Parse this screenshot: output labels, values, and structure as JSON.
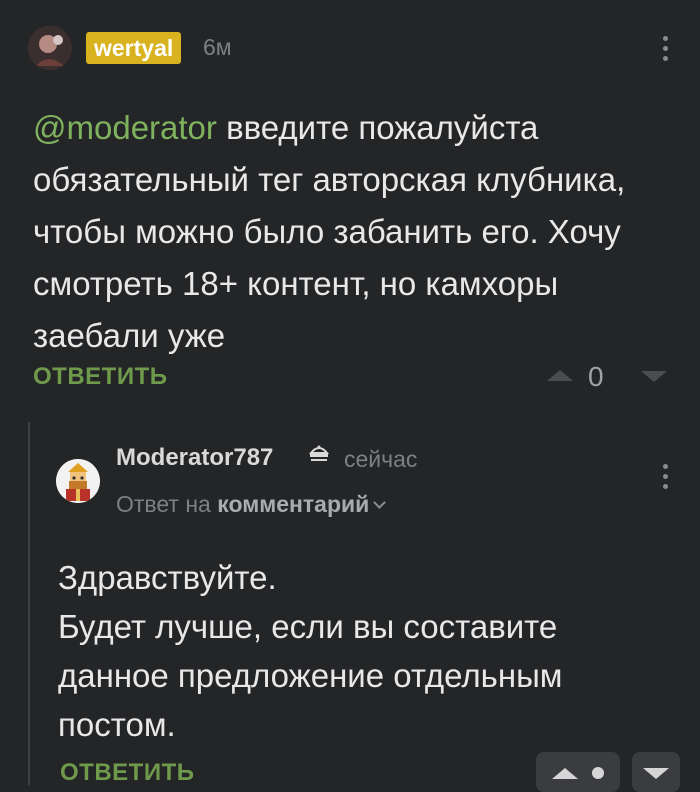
{
  "comment": {
    "author": "wertyal",
    "time": "6м",
    "mention": "@moderator",
    "text": " введите пожалуйста обязательный тег авторская клубника, чтобы можно было забанить его. Хочу смотреть 18+ контент, но камхоры заебали уже",
    "reply_label": "ОТВЕТИТЬ",
    "score": "0",
    "badge_color": "#d8b21f",
    "mention_color": "#7fb25e"
  },
  "reply": {
    "author": "Moderator787",
    "author_icon": "moderator-crown-icon",
    "time": "сейчас",
    "reply_to_prefix": "Ответ на",
    "reply_to_target": "комментарий",
    "lines": [
      "Здравствуйте.",
      "Будет лучше, если вы составите данное предложение отдельным постом."
    ],
    "reply_label": "ОТВЕТИТЬ"
  }
}
